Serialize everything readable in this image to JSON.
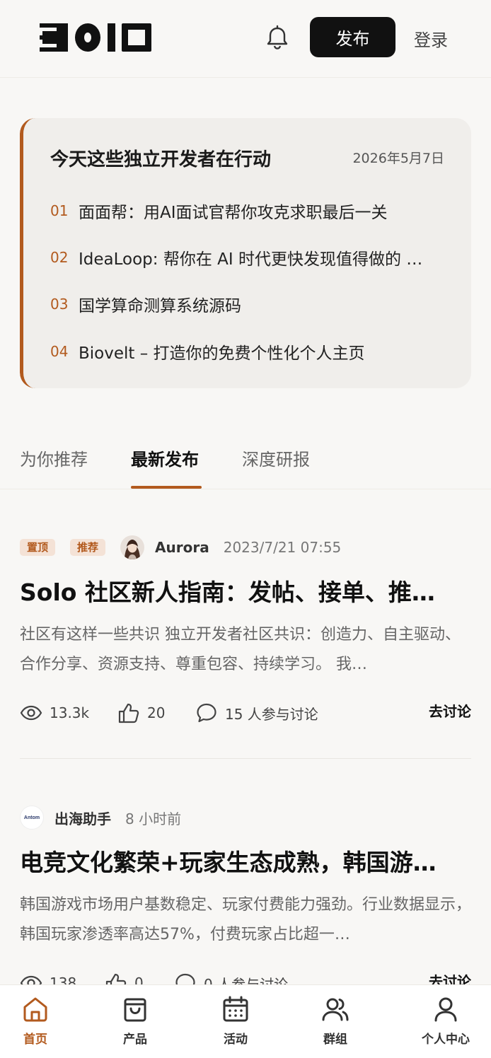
{
  "header": {
    "publish_label": "发布",
    "login_label": "登录"
  },
  "daily": {
    "title": "今天这些独立开发者在行动",
    "date": "2026年5月7日",
    "items": [
      {
        "num": "01",
        "text": "面面帮：用AI面试官帮你攻克求职最后一关"
      },
      {
        "num": "02",
        "text": "IdeaLoop: 帮你在 AI 时代更快发现值得做的 …"
      },
      {
        "num": "03",
        "text": "国学算命测算系统源码"
      },
      {
        "num": "04",
        "text": "Biovelt – 打造你的免费个性化个人主页"
      }
    ]
  },
  "tabs": [
    {
      "label": "为你推荐"
    },
    {
      "label": "最新发布"
    },
    {
      "label": "深度研报"
    }
  ],
  "posts": [
    {
      "badges": [
        "置顶",
        "推荐"
      ],
      "author": "Aurora",
      "time": "2023/7/21 07:55",
      "title": "Solo 社区新人指南：发帖、接单、推…",
      "excerpt": "社区有这样一些共识 独立开发者社区共识：创造力、自主驱动、合作分享、资源支持、尊重包容、持续学习。 我…",
      "views": "13.3k",
      "likes": "20",
      "comments": "15 人参与讨论",
      "discuss_label": "去讨论"
    },
    {
      "author": "出海助手",
      "avatar_text": "Antom",
      "time": "8 小时前",
      "title": "电竞文化繁荣+玩家生态成熟，韩国游…",
      "excerpt": "韩国游戏市场用户基数稳定、玩家付费能力强劲。行业数据显示，韩国玩家渗透率高达57%，付费玩家占比超一…",
      "views": "138",
      "likes": "0",
      "comments": "0 人参与讨论",
      "discuss_label": "去讨论"
    }
  ],
  "bottom_nav": [
    {
      "label": "首页",
      "icon": "home-icon"
    },
    {
      "label": "产品",
      "icon": "bag-icon"
    },
    {
      "label": "活动",
      "icon": "calendar-icon"
    },
    {
      "label": "群组",
      "icon": "group-icon"
    },
    {
      "label": "个人中心",
      "icon": "person-icon"
    }
  ],
  "colors": {
    "accent": "#b25a1e",
    "background": "#f8f7f5",
    "primary_button": "#111111"
  }
}
